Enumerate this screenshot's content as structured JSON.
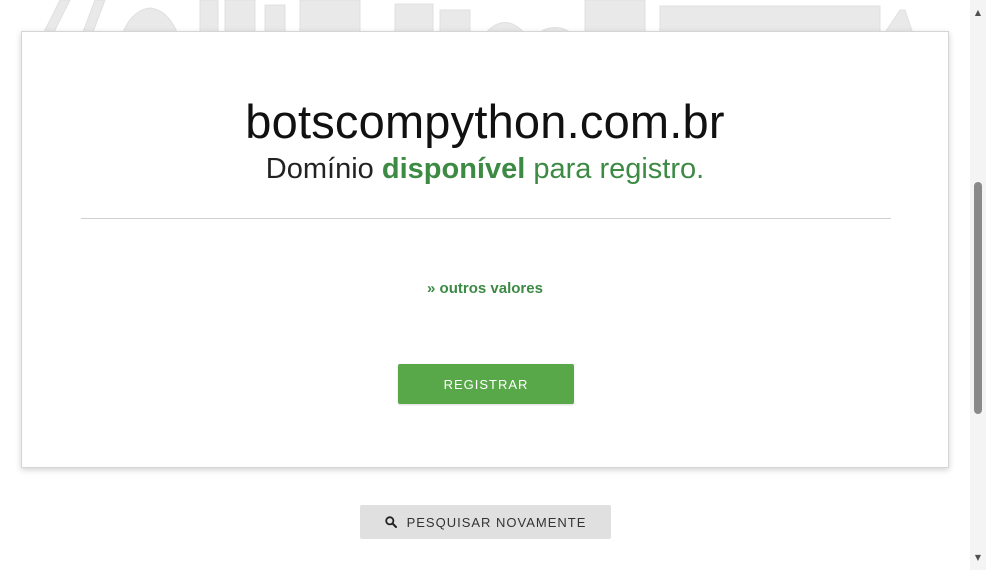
{
  "result": {
    "domain": "botscompython.com.br",
    "status_prefix": "Domínio",
    "status_highlight": "disponível",
    "status_suffix": "para registro."
  },
  "links": {
    "other_values": "» outros valores"
  },
  "buttons": {
    "register": "REGISTRAR",
    "search_again": "PESQUISAR NOVAMENTE"
  },
  "icons": {
    "search": "search-icon",
    "scroll_up": "chevron-up-icon",
    "scroll_down": "chevron-down-icon"
  },
  "colors": {
    "accent_green": "#3d8a45",
    "button_green": "#58a84a",
    "secondary_button": "#e0e0e0"
  }
}
